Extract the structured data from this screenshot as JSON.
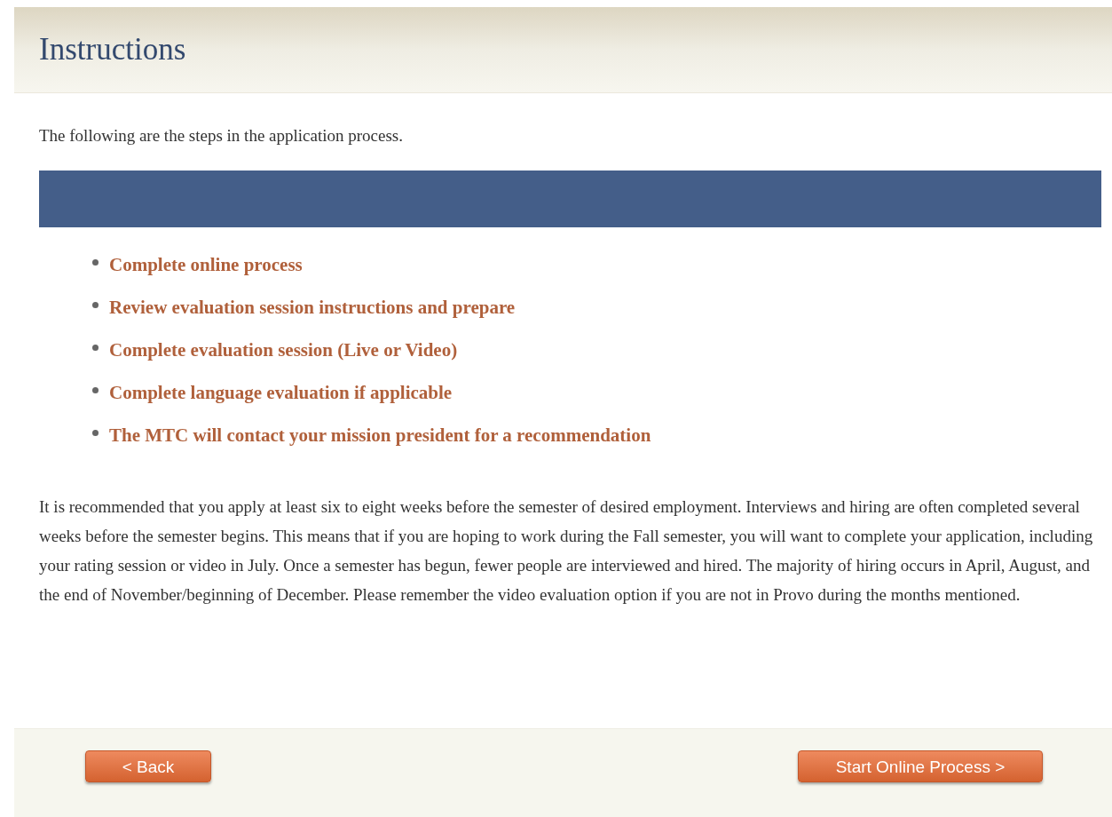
{
  "title": "Instructions",
  "intro": "The following are the steps in the application process.",
  "steps": [
    "Complete online process",
    "Review evaluation session instructions and prepare",
    "Complete evaluation session (Live or Video)",
    "Complete language evaluation if applicable",
    "The MTC will contact your mission president for a recommendation"
  ],
  "note": "It is recommended that you apply at least six to eight weeks before the semester of desired employment. Interviews and hiring are often completed several weeks before the semester begins. This means that if you are hoping to work during the Fall semester, you will want to complete your application, including your rating session or video in July. Once a semester has begun, fewer people are interviewed and hired. The majority of hiring occurs in April, August, and the end of November/beginning of December. Please remember the video evaluation option if you are not in Provo during the months mentioned.",
  "buttons": {
    "back": "< Back",
    "next": "Start Online Process >"
  }
}
